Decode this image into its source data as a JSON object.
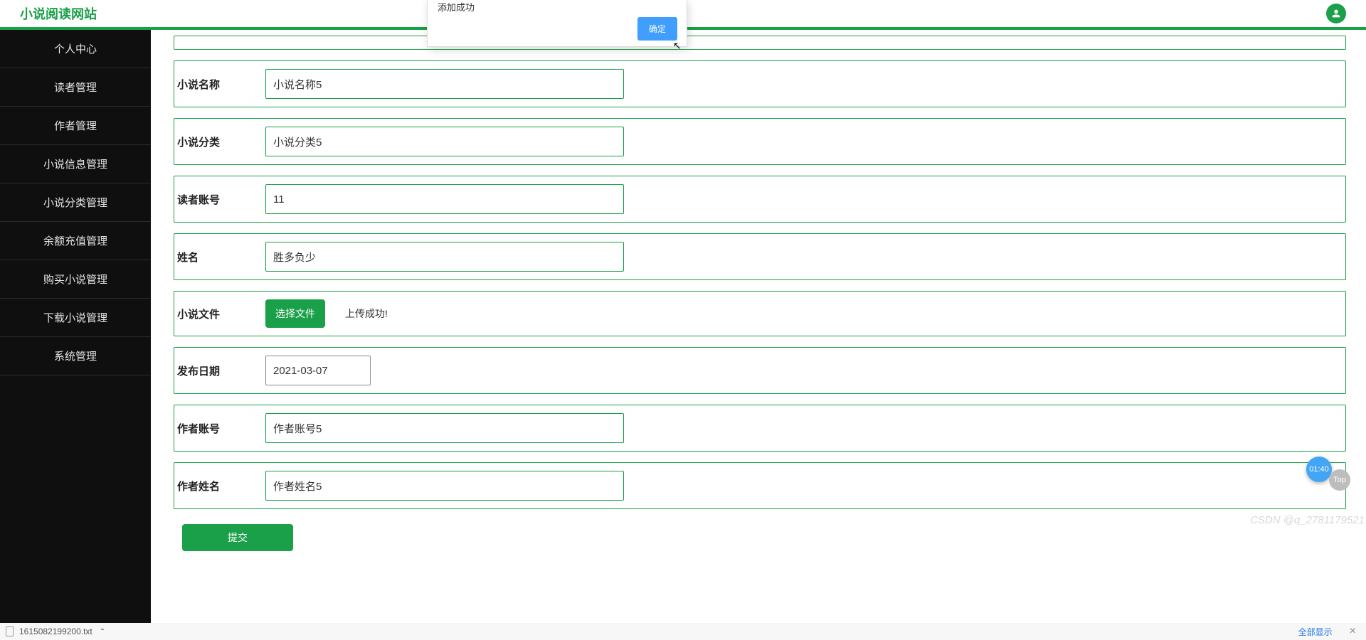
{
  "header": {
    "site_title": "小说阅读网站"
  },
  "sidebar": {
    "items": [
      {
        "label": "个人中心"
      },
      {
        "label": "读者管理"
      },
      {
        "label": "作者管理"
      },
      {
        "label": "小说信息管理"
      },
      {
        "label": "小说分类管理"
      },
      {
        "label": "余额充值管理"
      },
      {
        "label": "购买小说管理"
      },
      {
        "label": "下载小说管理"
      },
      {
        "label": "系统管理"
      }
    ]
  },
  "form": {
    "novel_name": {
      "label": "小说名称",
      "value": "小说名称5"
    },
    "novel_cat": {
      "label": "小说分类",
      "value": "小说分类5"
    },
    "reader_acc": {
      "label": "读者账号",
      "value": "11"
    },
    "name": {
      "label": "姓名",
      "value": "胜多负少"
    },
    "novel_file": {
      "label": "小说文件",
      "button": "选择文件",
      "status": "上传成功!"
    },
    "publish_date": {
      "label": "发布日期",
      "value": "2021-03-07"
    },
    "author_acc": {
      "label": "作者账号",
      "value": "作者账号5"
    },
    "author_name": {
      "label": "作者姓名",
      "value": "作者姓名5"
    },
    "submit_label": "提交"
  },
  "modal": {
    "message": "添加成功",
    "confirm_label": "确定"
  },
  "badges": {
    "timer": "01:40",
    "top": "Top"
  },
  "watermark": "CSDN @q_2781179521",
  "browser_bar": {
    "download_file": "1615082199200.txt",
    "show_all": "全部显示"
  }
}
